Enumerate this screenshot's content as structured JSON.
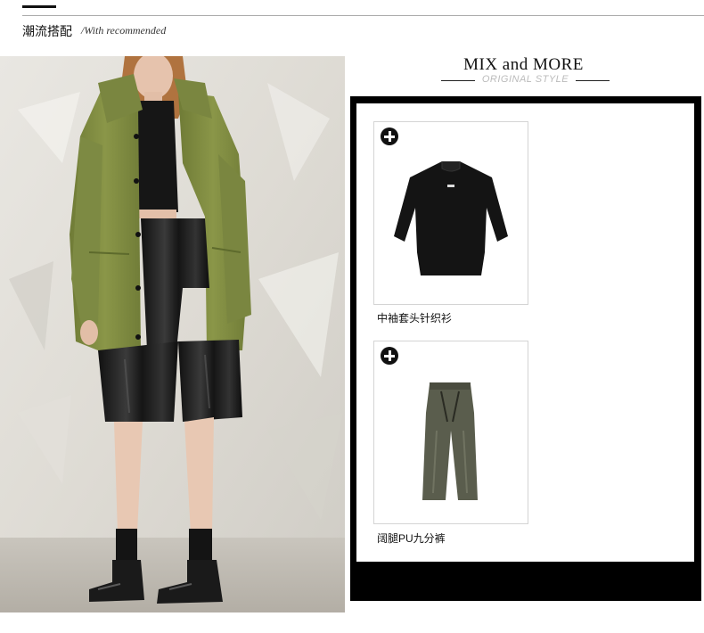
{
  "section": {
    "title": "潮流搭配",
    "subtitle": "/With recommended"
  },
  "mix": {
    "title": "MIX and MORE",
    "subtitle": "ORIGINAL STYLE"
  },
  "products": [
    {
      "name": "中袖套头针织衫",
      "icon": "plus-circle-icon"
    },
    {
      "name": "阔腿PU九分裤",
      "icon": "plus-circle-icon"
    }
  ],
  "colors": {
    "frame": "#000000",
    "coat": "#7d8a3f",
    "pants_product": "#5a5d4d",
    "card_border": "#d4d4d4"
  }
}
